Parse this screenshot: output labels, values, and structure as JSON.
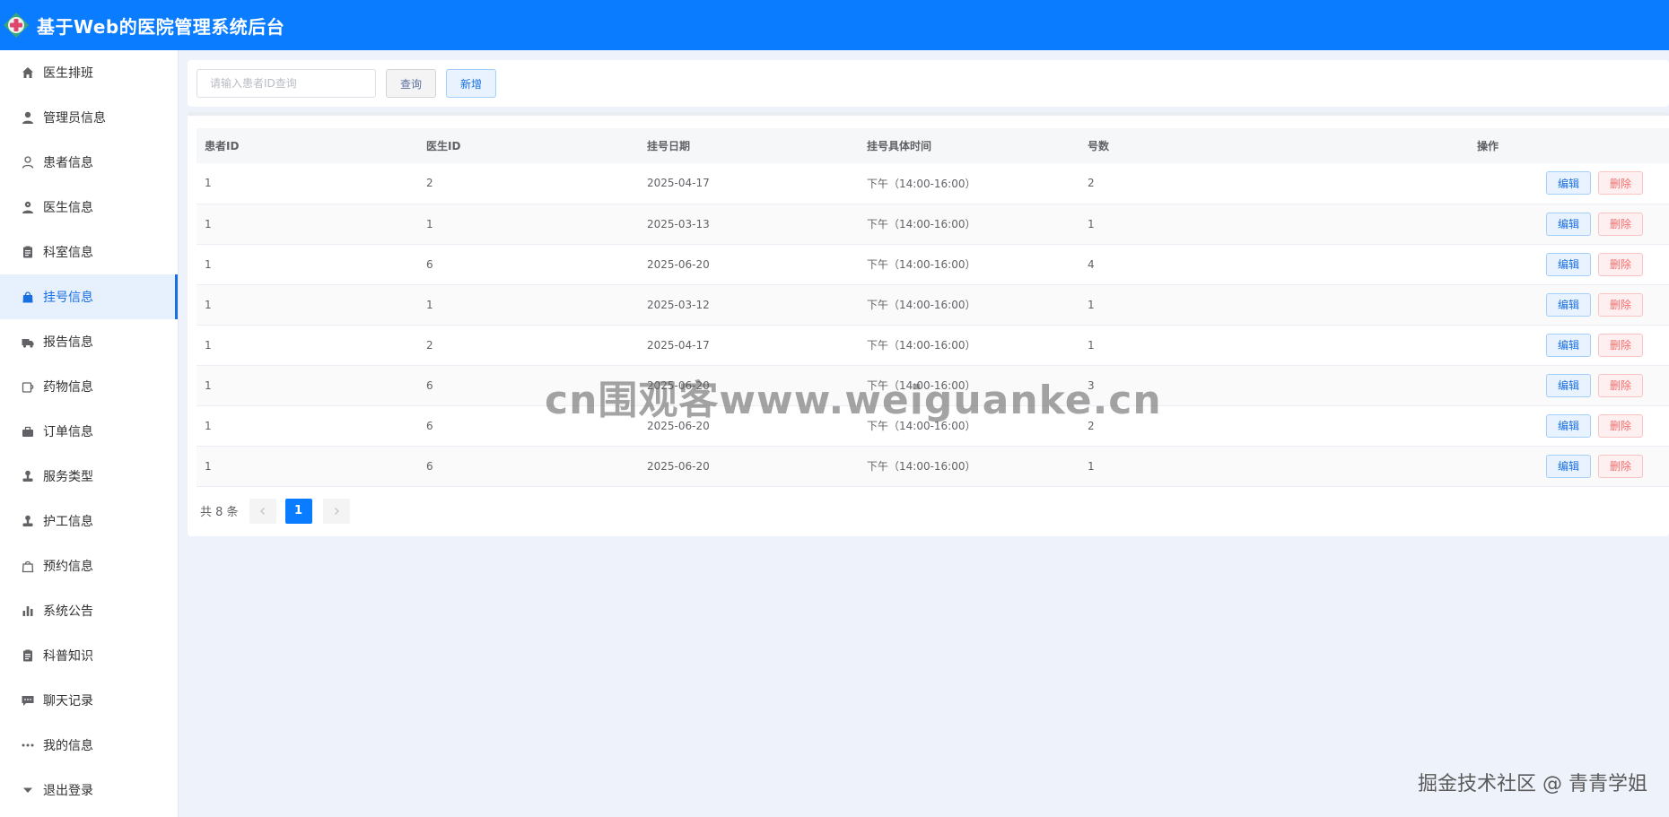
{
  "app": {
    "title": "基于Web的医院管理系统后台"
  },
  "sidebar": {
    "items": [
      {
        "label": "医生排班",
        "icon": "home-icon",
        "active": false
      },
      {
        "label": "管理员信息",
        "icon": "user-filled-icon",
        "active": false
      },
      {
        "label": "患者信息",
        "icon": "user-outline-icon",
        "active": false
      },
      {
        "label": "医生信息",
        "icon": "avatar-icon",
        "active": false
      },
      {
        "label": "科室信息",
        "icon": "clipboard-icon",
        "active": false
      },
      {
        "label": "挂号信息",
        "icon": "shopping-bag-icon",
        "active": true
      },
      {
        "label": "报告信息",
        "icon": "truck-icon",
        "active": false
      },
      {
        "label": "药物信息",
        "icon": "coffee-cup-icon",
        "active": false
      },
      {
        "label": "订单信息",
        "icon": "briefcase-icon",
        "active": false
      },
      {
        "label": "服务类型",
        "icon": "user-stamp-icon",
        "active": false
      },
      {
        "label": "护工信息",
        "icon": "user-stamp-icon",
        "active": false
      },
      {
        "label": "预约信息",
        "icon": "handbag-icon",
        "active": false
      },
      {
        "label": "系统公告",
        "icon": "histogram-icon",
        "active": false
      },
      {
        "label": "科普知识",
        "icon": "clipboard-icon",
        "active": false
      },
      {
        "label": "聊天记录",
        "icon": "chat-icon",
        "active": false
      },
      {
        "label": "我的信息",
        "icon": "more-icon",
        "active": false
      },
      {
        "label": "退出登录",
        "icon": "caret-down-icon",
        "active": false
      }
    ]
  },
  "toolbar": {
    "search_placeholder": "请输入患者ID查询",
    "query_label": "查询",
    "add_label": "新增"
  },
  "table": {
    "headers": [
      "患者ID",
      "医生ID",
      "挂号日期",
      "挂号具体时间",
      "号数",
      "操作"
    ],
    "rows": [
      [
        "1",
        "2",
        "2025-04-17",
        "下午（14:00-16:00）",
        "2"
      ],
      [
        "1",
        "1",
        "2025-03-13",
        "下午（14:00-16:00）",
        "1"
      ],
      [
        "1",
        "6",
        "2025-06-20",
        "下午（14:00-16:00）",
        "4"
      ],
      [
        "1",
        "1",
        "2025-03-12",
        "下午（14:00-16:00）",
        "1"
      ],
      [
        "1",
        "2",
        "2025-04-17",
        "下午（14:00-16:00）",
        "1"
      ],
      [
        "1",
        "6",
        "2025-06-20",
        "下午（14:00-16:00）",
        "3"
      ],
      [
        "1",
        "6",
        "2025-06-20",
        "下午（14:00-16:00）",
        "2"
      ],
      [
        "1",
        "6",
        "2025-06-20",
        "下午（14:00-16:00）",
        "1"
      ]
    ],
    "edit_label": "编辑",
    "delete_label": "删除"
  },
  "pagination": {
    "total_text": "共 8 条",
    "current_page": "1"
  },
  "overlay": {
    "watermark": "cn围观客www.weiguanke.cn",
    "credit": "掘金技术社区 @ 青青学姐"
  },
  "colors": {
    "brand": "#0a7cff",
    "active_menu_bg": "#e6f1fd",
    "danger": "#f56c6c"
  }
}
